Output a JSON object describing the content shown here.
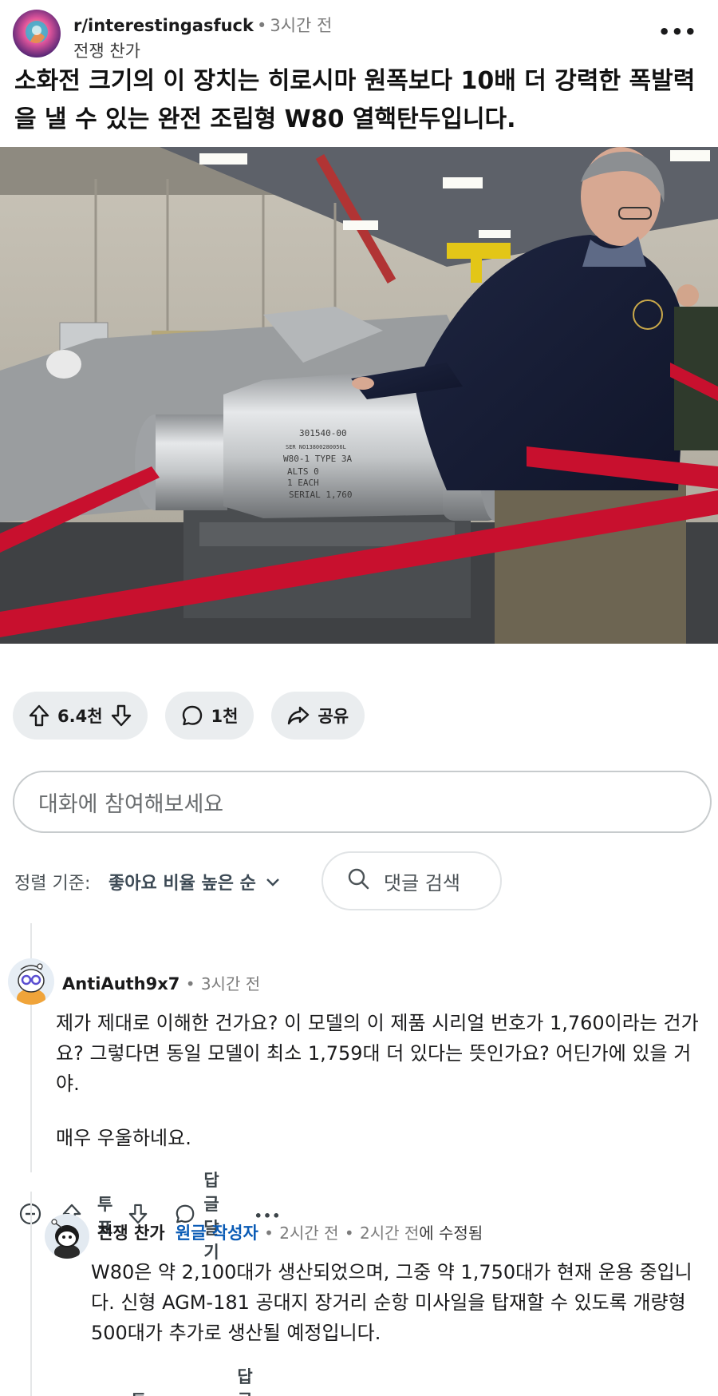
{
  "post": {
    "subreddit": "r/interestingasfuck",
    "time": "3시간 전",
    "author": "전쟁 찬가",
    "title": "소화전 크기의 이 장치는 히로시마 원폭보다 10배 더 강력한 폭발력을 낼 수 있는 완전 조립형 W80 열핵탄두입니다.",
    "image_stencil": [
      "301540-00",
      "SER NO13800280056L",
      "W80-1 TYPE 3A",
      "ALTS 0",
      "1 EACH",
      "SERIAL 1,760"
    ]
  },
  "actions": {
    "votes": "6.4천",
    "comments": "1천",
    "share": "공유"
  },
  "comment_box": {
    "placeholder": "대화에 참여해보세요"
  },
  "sort": {
    "label": "정렬 기준:",
    "value": "좋아요 비율 높은 순",
    "search": "댓글 검색"
  },
  "comments": [
    {
      "author": "AntiAuth9x7",
      "time": "3시간 전",
      "body1": "제가 제대로 이해한 건가요? 이 모델의 이 제품 시리얼 번호가 1,760이라는 건가요? 그렇다면 동일 모델이 최소 1,759대 더 있다는 뜻인가요? 어딘가에 있을 거야.",
      "body2": "매우 우울하네요.",
      "vote_label": "투표",
      "reply_label": "답글 달기"
    },
    {
      "author": "전쟁 찬가",
      "op_badge": "원글 작성자",
      "time": "2시간 전",
      "edited_time": "2시간 전",
      "edited_suffix": "에 수정됨",
      "body": "W80은 약 2,100대가 생산되었으며, 그중 약 1,750대가 현재 운용 중입니다. 신형 AGM-181 공대지 장거리 순항 미사일을 탑재할 수 있도록 개량형 500대가 추가로 생산될 예정입니다.",
      "vote_label": "투표",
      "reply_label": "답글 달기"
    }
  ],
  "separator": "•",
  "more": "•••",
  "colors": {
    "pill_bg": "#eaedef",
    "op_badge": "#0a5bb5",
    "ribbon": "#c8102e"
  }
}
